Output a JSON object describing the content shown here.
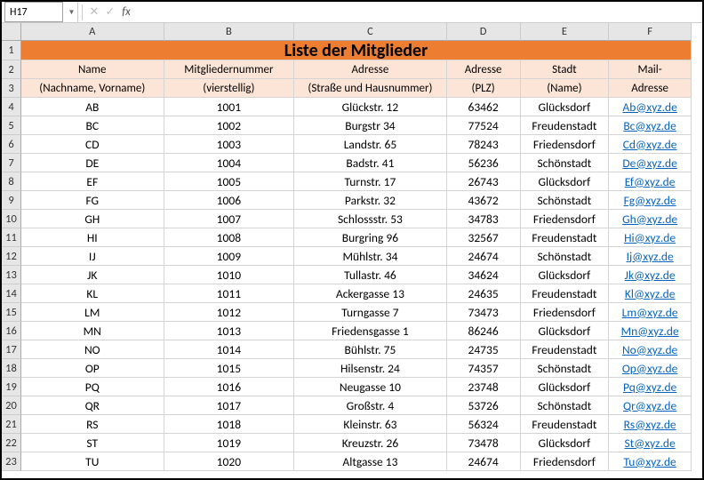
{
  "formula_bar": {
    "name_box": "H17",
    "dropdown_glyph": "▼",
    "cancel_glyph": "✕",
    "confirm_glyph": "✓",
    "fx_label": "fx",
    "input_value": ""
  },
  "columns": [
    {
      "letter": "A",
      "class": "col-A"
    },
    {
      "letter": "B",
      "class": "col-B"
    },
    {
      "letter": "C",
      "class": "col-C"
    },
    {
      "letter": "D",
      "class": "col-D"
    },
    {
      "letter": "E",
      "class": "col-E"
    },
    {
      "letter": "F",
      "class": "col-F"
    }
  ],
  "title": "Liste der Mitglieder",
  "header1": {
    "A": "Name",
    "B": "Mitgliedernummer",
    "C": "Adresse",
    "D": "Adresse",
    "E": "Stadt",
    "F": "Mail-"
  },
  "header2": {
    "A": "(Nachname, Vorname)",
    "B": "(vierstellig)",
    "C": "(Straße und Hausnummer)",
    "D": "(PLZ)",
    "E": "(Name)",
    "F": "Adresse"
  },
  "rows": [
    {
      "n": 4,
      "name": "AB",
      "num": "1001",
      "addr": "Glückstr. 12",
      "plz": "63462",
      "city": "Glücksdorf",
      "mail": "Ab@xyz.de"
    },
    {
      "n": 5,
      "name": "BC",
      "num": "1002",
      "addr": "Burgstr 34",
      "plz": "77524",
      "city": "Freudenstadt",
      "mail": "Bc@xyz.de"
    },
    {
      "n": 6,
      "name": "CD",
      "num": "1003",
      "addr": "Landstr. 65",
      "plz": "78243",
      "city": "Friedensdorf",
      "mail": "Cd@xyz.de"
    },
    {
      "n": 7,
      "name": "DE",
      "num": "1004",
      "addr": "Badstr. 41",
      "plz": "56236",
      "city": "Schönstadt",
      "mail": "De@xyz.de"
    },
    {
      "n": 8,
      "name": "EF",
      "num": "1005",
      "addr": "Turnstr. 17",
      "plz": "26743",
      "city": "Glücksdorf",
      "mail": "Ef@xyz.de"
    },
    {
      "n": 9,
      "name": "FG",
      "num": "1006",
      "addr": "Parkstr. 32",
      "plz": "43672",
      "city": "Schönstadt",
      "mail": "Fg@xyz.de"
    },
    {
      "n": 10,
      "name": "GH",
      "num": "1007",
      "addr": "Schlossstr. 53",
      "plz": "34783",
      "city": "Friedensdorf",
      "mail": "Gh@xyz.de"
    },
    {
      "n": 11,
      "name": "HI",
      "num": "1008",
      "addr": "Burgring 96",
      "plz": "32567",
      "city": "Freudenstadt",
      "mail": "Hi@xyz.de"
    },
    {
      "n": 12,
      "name": "IJ",
      "num": "1009",
      "addr": "Mühlstr. 34",
      "plz": "24674",
      "city": "Schönstadt",
      "mail": "Ij@xyz.de"
    },
    {
      "n": 13,
      "name": "JK",
      "num": "1010",
      "addr": "Tullastr. 46",
      "plz": "34624",
      "city": "Glücksdorf",
      "mail": "Jk@xyz.de"
    },
    {
      "n": 14,
      "name": "KL",
      "num": "1011",
      "addr": "Ackergasse 13",
      "plz": "24635",
      "city": "Freudenstadt",
      "mail": "Kl@xyz.de"
    },
    {
      "n": 15,
      "name": "LM",
      "num": "1012",
      "addr": "Turngasse 7",
      "plz": "73473",
      "city": "Friedensdorf",
      "mail": "Lm@xyz.de"
    },
    {
      "n": 16,
      "name": "MN",
      "num": "1013",
      "addr": "Friedensgasse 1",
      "plz": "86246",
      "city": "Glücksdorf",
      "mail": "Mn@xyz.de"
    },
    {
      "n": 17,
      "name": "NO",
      "num": "1014",
      "addr": "Bühlstr. 75",
      "plz": "24735",
      "city": "Freudenstadt",
      "mail": "No@xyz.de"
    },
    {
      "n": 18,
      "name": "OP",
      "num": "1015",
      "addr": "Hilsenstr. 24",
      "plz": "74357",
      "city": "Schönstadt",
      "mail": "Op@xyz.de"
    },
    {
      "n": 19,
      "name": "PQ",
      "num": "1016",
      "addr": "Neugasse 10",
      "plz": "23748",
      "city": "Glücksdorf",
      "mail": "Pq@xyz.de"
    },
    {
      "n": 20,
      "name": "QR",
      "num": "1017",
      "addr": "Großstr. 4",
      "plz": "53726",
      "city": "Schönstadt",
      "mail": "Qr@xyz.de"
    },
    {
      "n": 21,
      "name": "RS",
      "num": "1018",
      "addr": "Kleinstr. 63",
      "plz": "56324",
      "city": "Freudenstadt",
      "mail": "Rs@xyz.de"
    },
    {
      "n": 22,
      "name": "ST",
      "num": "1019",
      "addr": "Kreuzstr. 26",
      "plz": "73478",
      "city": "Glücksdorf",
      "mail": "St@xyz.de"
    },
    {
      "n": 23,
      "name": "TU",
      "num": "1020",
      "addr": "Altgasse 13",
      "plz": "24674",
      "city": "Friedensdorf",
      "mail": "Tu@xyz.de"
    }
  ]
}
